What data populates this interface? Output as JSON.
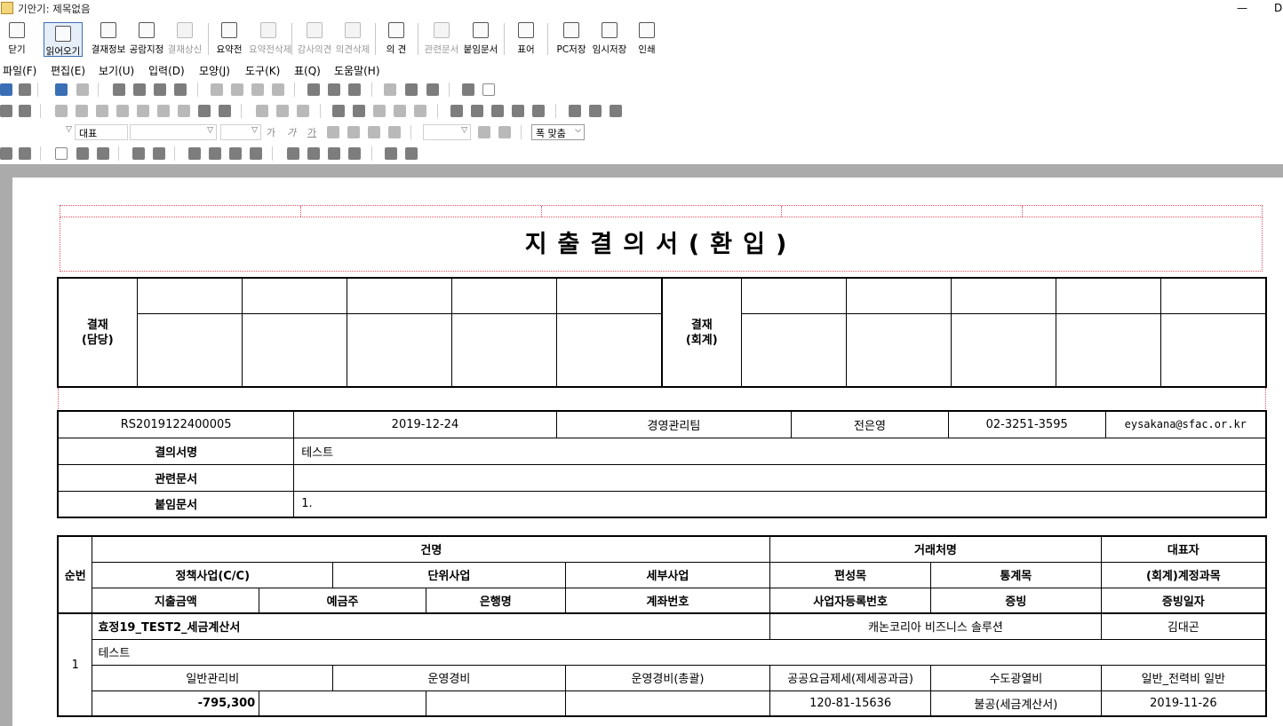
{
  "window": {
    "title": "기안기: 제목없음",
    "min": "—",
    "max": "D"
  },
  "toolbar": [
    {
      "label": "닫기",
      "icon": "close-door-icon",
      "disabled": false
    },
    {
      "label": "읽어오기",
      "icon": "open-file-icon",
      "disabled": false
    },
    {
      "label": "결재정보",
      "icon": "approval-info-icon",
      "disabled": false
    },
    {
      "label": "공람지정",
      "icon": "people-icon",
      "disabled": false
    },
    {
      "label": "결재상신",
      "icon": "submit-icon",
      "disabled": true
    },
    {
      "label": "요약전",
      "icon": "summary-icon",
      "disabled": false
    },
    {
      "label": "요약전삭제",
      "icon": "summary-delete-icon",
      "disabled": true
    },
    {
      "label": "감사의견",
      "icon": "audit-opinion-icon",
      "disabled": true
    },
    {
      "label": "의견삭제",
      "icon": "opinion-delete-icon",
      "disabled": true
    },
    {
      "label": "의 견",
      "icon": "opinion-icon",
      "disabled": false
    },
    {
      "label": "관련문서",
      "icon": "related-doc-icon",
      "disabled": true
    },
    {
      "label": "붙임문서",
      "icon": "attach-doc-icon",
      "disabled": false
    },
    {
      "label": "표어",
      "icon": "slogan-icon",
      "disabled": false
    },
    {
      "label": "PC저장",
      "icon": "pc-save-icon",
      "disabled": false
    },
    {
      "label": "임시저장",
      "icon": "temp-save-icon",
      "disabled": false
    },
    {
      "label": "인쇄",
      "icon": "print-icon",
      "disabled": false
    }
  ],
  "menu": [
    "파일(F)",
    "편집(E)",
    "보기(U)",
    "입력(D)",
    "모양(J)",
    "도구(K)",
    "표(Q)",
    "도움말(H)"
  ],
  "format": {
    "style": "대표",
    "font": "",
    "size": "",
    "fit": "폭 맞춤",
    "bold": "가",
    "italic": "가",
    "underline": "가"
  },
  "doc": {
    "title": "지출결의서(환입)",
    "approval": {
      "label_left": "결재\n(담당)",
      "label_right": "결재\n(회계)"
    },
    "info": {
      "doc_no": "RS2019122400005",
      "date": "2019-12-24",
      "team": "경영관리팀",
      "person": "전은영",
      "phone": "02-3251-3595",
      "email": "eysakana@sfac.or.kr"
    },
    "rows": [
      {
        "label": "결의서명",
        "value": "테스트"
      },
      {
        "label": "관련문서",
        "value": ""
      },
      {
        "label": "붙임문서",
        "value": "1."
      }
    ],
    "detail": {
      "headers": {
        "seq": "순번",
        "subject": "건명",
        "vendor": "거래처명",
        "rep": "대표자",
        "policy": "정책사업(C/C)",
        "unit": "단위사업",
        "sub": "세부사업",
        "budget": "편성목",
        "stat": "통계목",
        "acct": "(회계)계정과목",
        "amount": "지출금액",
        "holder": "예금주",
        "bank": "은행명",
        "account": "계좌번호",
        "bizno": "사업자등록번호",
        "proof": "증빙",
        "proofdate": "증빙일자"
      },
      "item": {
        "seq": "1",
        "subject": "효정19_TEST2_세금계산서",
        "vendor": "캐논코리아 비즈니스 솔루션",
        "rep": "김대곤",
        "desc": "테스트",
        "policy": "일반관리비",
        "unit": "운영경비",
        "sub": "운영경비(총괄)",
        "budget": "공공요금제세(제세공과금)",
        "stat": "수도광열비",
        "acct": "일반_전력비 일반",
        "amount": "-795,300",
        "holder": "",
        "bank": "",
        "account": "",
        "bizno": "120-81-15636",
        "proof": "불공(세금계산서)",
        "proofdate": "2019-11-26"
      }
    }
  }
}
